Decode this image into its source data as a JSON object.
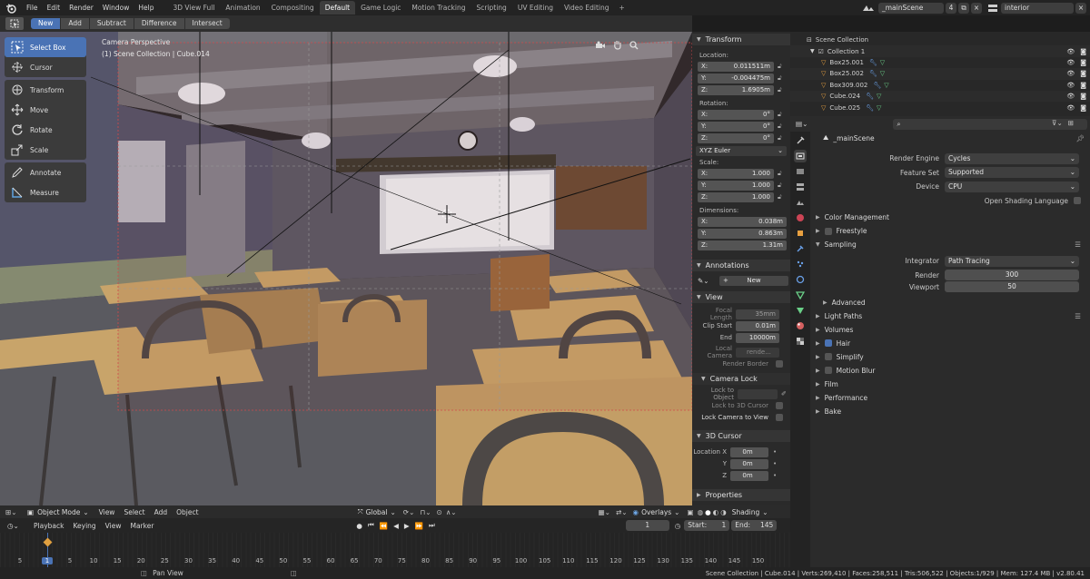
{
  "topbar": {
    "menu": [
      "File",
      "Edit",
      "Render",
      "Window",
      "Help"
    ],
    "workspaces": [
      "3D View Full",
      "Animation",
      "Compositing",
      "Default",
      "Game Logic",
      "Motion Tracking",
      "Scripting",
      "UV Editing",
      "Video Editing"
    ],
    "active_workspace": "Default",
    "plus": "+",
    "scene_name": "_mainScene",
    "scene_users": "4",
    "view_layer": "interior"
  },
  "toolheader": {
    "modes": [
      "New",
      "Add",
      "Subtract",
      "Difference",
      "Intersect"
    ],
    "active_mode": "New"
  },
  "viewport": {
    "title": "Camera Perspective",
    "subtitle": "(1) Scene Collection | Cube.014"
  },
  "toolbar": {
    "group1": [
      "Select Box",
      "Cursor"
    ],
    "group2": [
      "Transform",
      "Move",
      "Rotate",
      "Scale"
    ],
    "group3": [
      "Annotate",
      "Measure"
    ]
  },
  "npanel": {
    "transform_title": "Transform",
    "location_label": "Location:",
    "location": [
      {
        "axis": "X:",
        "value": "0.011511m"
      },
      {
        "axis": "Y:",
        "value": "-0.004475m"
      },
      {
        "axis": "Z:",
        "value": "1.6905m"
      }
    ],
    "rotation_label": "Rotation:",
    "rotation": [
      {
        "axis": "X:",
        "value": "0°"
      },
      {
        "axis": "Y:",
        "value": "0°"
      },
      {
        "axis": "Z:",
        "value": "0°"
      }
    ],
    "rotation_mode": "XYZ Euler",
    "scale_label": "Scale:",
    "scale": [
      {
        "axis": "X:",
        "value": "1.000"
      },
      {
        "axis": "Y:",
        "value": "1.000"
      },
      {
        "axis": "Z:",
        "value": "1.000"
      }
    ],
    "dimensions_label": "Dimensions:",
    "dimensions": [
      {
        "axis": "X:",
        "value": "0.038m"
      },
      {
        "axis": "Y:",
        "value": "0.863m"
      },
      {
        "axis": "Z:",
        "value": "1.31m"
      }
    ],
    "annotations_title": "Annotations",
    "annotations_new": "New",
    "view_title": "View",
    "focal_length_label": "Focal Length",
    "focal_length": "35mm",
    "clip_start_label": "Clip Start",
    "clip_start": "0.01m",
    "clip_end_label": "End",
    "clip_end": "10000m",
    "local_camera_label": "Local Camera",
    "local_camera_value": "rende...",
    "render_border_label": "Render Border",
    "camera_lock_title": "Camera Lock",
    "lock_to_object_label": "Lock to Object",
    "lock_to_cursor_label": "Lock to 3D Cursor",
    "lock_camera_view_label": "Lock Camera to View",
    "cursor_title": "3D Cursor",
    "cursor_location_label": "Location X",
    "cursor": [
      {
        "axis": "Location X",
        "value": "0m"
      },
      {
        "axis": "Y",
        "value": "0m"
      },
      {
        "axis": "Z",
        "value": "0m"
      }
    ],
    "properties_title": "Properties"
  },
  "viewport_header": {
    "items": [
      "Object Mode",
      "View",
      "Select",
      "Add",
      "Object"
    ],
    "orientation": "Global",
    "overlays": "Overlays",
    "shading": "Shading"
  },
  "timeline": {
    "menu": [
      "Playback",
      "Keying",
      "View",
      "Marker"
    ],
    "current_frame": "1",
    "start_label": "Start:",
    "start": "1",
    "end_label": "End:",
    "end": "145",
    "ticks": [
      "5",
      "1",
      "5",
      "10",
      "15",
      "20",
      "25",
      "30",
      "35",
      "40",
      "45",
      "50",
      "55",
      "60",
      "65",
      "70",
      "75",
      "80",
      "85",
      "90",
      "95",
      "100",
      "105",
      "110",
      "115",
      "120",
      "125",
      "130",
      "135",
      "140",
      "145",
      "150"
    ]
  },
  "statusbar": {
    "left_hint": "Pan View",
    "info": "Scene Collection | Cube.014 | Verts:269,410 | Faces:258,511 | Tris:506,522 | Objects:1/929 | Mem: 127.4 MB | v2.80.41"
  },
  "outliner": {
    "root": "Scene Collection",
    "collection": "Collection 1",
    "items": [
      "Box25.001",
      "Box25.002",
      "Box309.002",
      "Cube.024",
      "Cube.025"
    ]
  },
  "properties": {
    "scene": "_mainScene",
    "render_engine_label": "Render Engine",
    "render_engine": "Cycles",
    "feature_set_label": "Feature Set",
    "feature_set": "Supported",
    "device_label": "Device",
    "device": "CPU",
    "osl_label": "Open Shading Language",
    "color_management": "Color Management",
    "freestyle": "Freestyle",
    "sampling": "Sampling",
    "integrator_label": "Integrator",
    "integrator": "Path Tracing",
    "render_label": "Render",
    "render_samples": "300",
    "viewport_label": "Viewport",
    "viewport_samples": "50",
    "advanced": "Advanced",
    "light_paths": "Light Paths",
    "volumes": "Volumes",
    "hair": "Hair",
    "simplify": "Simplify",
    "motion_blur": "Motion Blur",
    "film": "Film",
    "performance": "Performance",
    "bake": "Bake"
  }
}
